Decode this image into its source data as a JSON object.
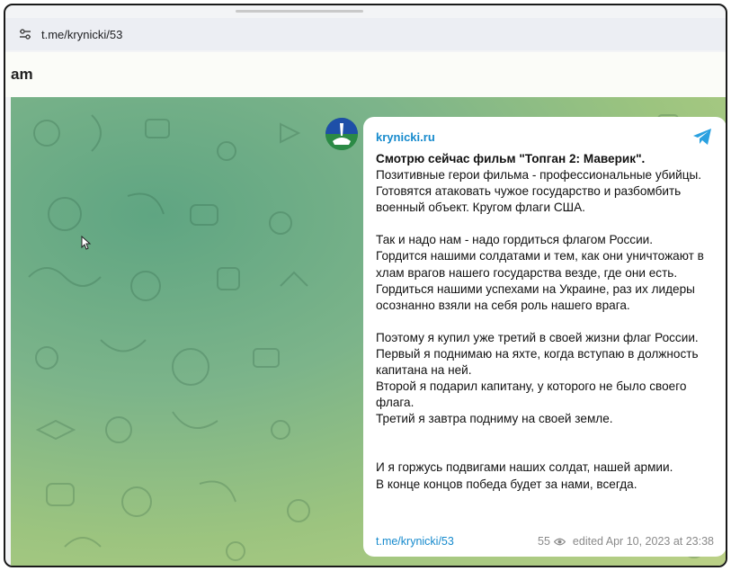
{
  "browser": {
    "url": "t.me/krynicki/53",
    "site_icon": "tune-icon"
  },
  "page": {
    "header_title": "am"
  },
  "post": {
    "channel_name": "krynicki.ru",
    "lead": "Смотрю сейчас фильм \"Топган 2: Маверик\".",
    "paragraphs": [
      [
        "Позитивные герои фильма - профессиональные убийцы. Готовятся атаковать чужое государство и разбомбить военный объект. Кругом флаги США."
      ],
      [
        "Так и надо нам - надо гордиться флагом России.",
        "Гордится нашими солдатами и тем, как они уничтожают в хлам врагов нашего государства везде, где они есть.",
        "Гордиться нашими успехами на Украине, раз их лидеры осознанно взяли на себя роль нашего врага."
      ],
      [
        "Поэтому я купил уже третий в своей жизни флаг России.",
        "Первый я поднимаю на яхте, когда вступаю в должность капитана на ней.",
        "Второй я подарил капитану, у которого не было своего флага.",
        "Третий я завтра подниму на своей земле."
      ],
      [
        "И я горжусь подвигами наших солдат, нашей армии.",
        "В конце концов победа будет за нами, всегда."
      ]
    ],
    "link": "t.me/krynicki/53",
    "views": "55",
    "edited": "edited  Apr 10, 2023 at 23:38"
  },
  "colors": {
    "link": "#168acd",
    "telegram": "#2aa1e0",
    "wallpaper_dark": "#5fa582",
    "wallpaper_light": "#bcd187"
  }
}
